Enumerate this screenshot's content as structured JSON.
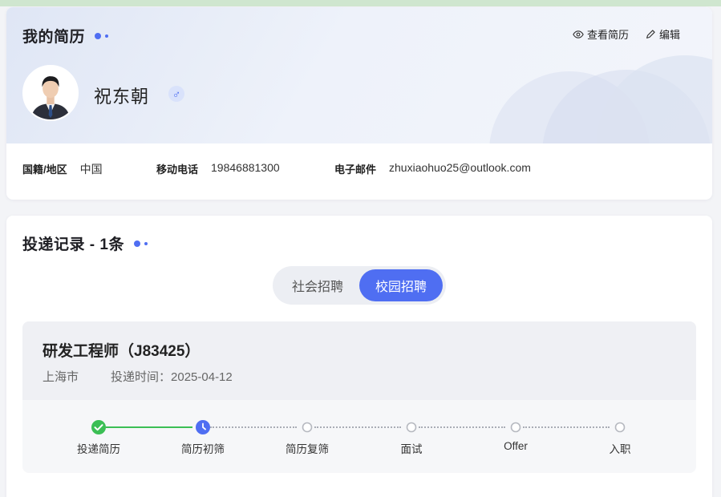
{
  "profile": {
    "section_title": "我的简历",
    "actions": {
      "view": "查看简历",
      "edit": "编辑"
    },
    "name": "祝东朝",
    "gender_symbol": "♂",
    "info": [
      {
        "label": "国籍/地区",
        "value": "中国"
      },
      {
        "label": "移动电话",
        "value": "19846881300"
      },
      {
        "label": "电子邮件",
        "value": "zhuxiaohuo25@outlook.com"
      }
    ]
  },
  "applications": {
    "section_title": "投递记录 - 1条",
    "tabs": [
      {
        "label": "社会招聘",
        "active": false
      },
      {
        "label": "校园招聘",
        "active": true
      }
    ],
    "job": {
      "title": "研发工程师（J83425）",
      "city": "上海市",
      "submitted": "投递时间：2025-04-12",
      "steps": [
        {
          "label": "投递简历",
          "status": "done"
        },
        {
          "label": "简历初筛",
          "status": "current"
        },
        {
          "label": "简历复筛",
          "status": "pending"
        },
        {
          "label": "面试",
          "status": "pending"
        },
        {
          "label": "Offer",
          "status": "pending"
        },
        {
          "label": "入职",
          "status": "pending"
        }
      ]
    }
  },
  "colors": {
    "accent": "#4f6ef2",
    "success": "#3bbf55",
    "pending": "#b6b9c0"
  }
}
